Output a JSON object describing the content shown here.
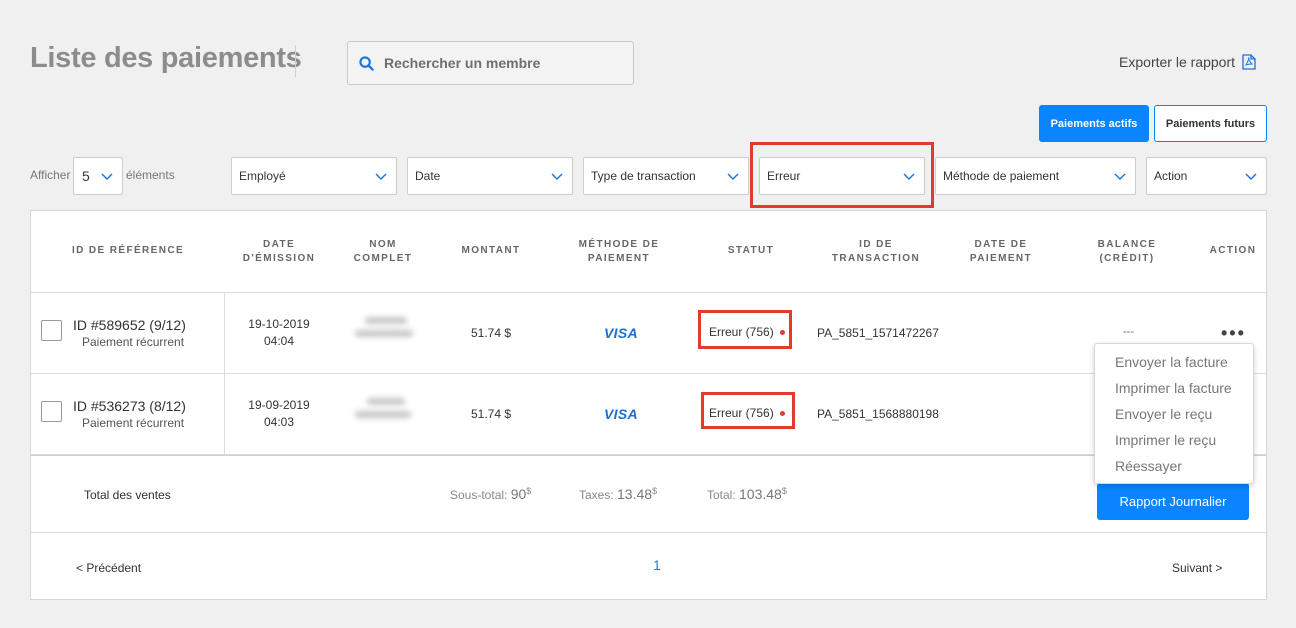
{
  "header": {
    "title": "Liste des paiements",
    "search_placeholder": "Rechercher un membre",
    "export_label": "Exporter le rapport"
  },
  "tabs": {
    "active_label": "Paiements actifs",
    "future_label": "Paiements futurs"
  },
  "pagination_size": {
    "prefix": "Afficher",
    "value": "5",
    "suffix": "éléments"
  },
  "filters": {
    "employee": "Employé",
    "date": "Date",
    "transaction_type": "Type de transaction",
    "status": "Erreur",
    "payment_method": "Méthode de paiement",
    "action": "Action"
  },
  "table": {
    "headers": {
      "ref_id": "ID DE RÉFÉRENCE",
      "issue_date_1": "DATE",
      "issue_date_2": "D'ÉMISSION",
      "full_name_1": "NOM",
      "full_name_2": "COMPLET",
      "amount": "MONTANT",
      "method_1": "MÉTHODE DE",
      "method_2": "PAIEMENT",
      "status": "STATUT",
      "txid_1": "ID DE",
      "txid_2": "TRANSACTION",
      "paydate_1": "DATE DE",
      "paydate_2": "PAIEMENT",
      "balance_1": "BALANCE",
      "balance_2": "(CRÉDIT)",
      "action": "ACTION"
    },
    "rows": [
      {
        "ref_id": "ID #589652 (9/12)",
        "ref_type": "Paiement récurrent",
        "date": "19-10-2019",
        "time": "04:04",
        "amount": "51.74 $",
        "method": "VISA",
        "status": "Erreur (756)",
        "txid": "PA_5851_1571472267",
        "balance": "---",
        "action": "•••"
      },
      {
        "ref_id": "ID #536273 (8/12)",
        "ref_type": "Paiement récurrent",
        "date": "19-09-2019",
        "time": "04:03",
        "amount": "51.74 $",
        "method": "VISA",
        "status": "Erreur (756)",
        "txid": "PA_5851_1568880198",
        "balance": "",
        "action": ""
      }
    ]
  },
  "totals": {
    "label": "Total des ventes",
    "subtotal_label": "Sous-total: ",
    "subtotal_value": "90",
    "taxes_label": "Taxes: ",
    "taxes_value": "13.48",
    "total_label": "Total: ",
    "total_value": "103.48",
    "currency": "$",
    "report_button": "Rapport Journalier"
  },
  "pagination": {
    "prev": "<  Précédent",
    "current": "1",
    "next": "Suivant  >"
  },
  "action_menu": {
    "items": [
      "Envoyer la facture",
      "Imprimer la facture",
      "Envoyer le reçu",
      "Imprimer le reçu",
      "Réessayer"
    ]
  },
  "colors": {
    "accent": "#0a84ff",
    "highlight": "#e23b2e",
    "visa": "#1a6fd1"
  }
}
